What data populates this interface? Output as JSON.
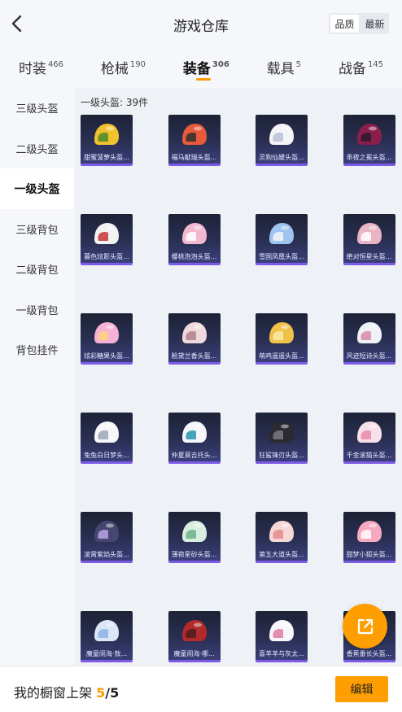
{
  "header": {
    "title": "游戏仓库",
    "sort_options": [
      "品质",
      "最新"
    ],
    "sort_selected": "品质"
  },
  "tabs": [
    {
      "label": "时装",
      "count": "466",
      "active": false
    },
    {
      "label": "枪械",
      "count": "190",
      "active": false
    },
    {
      "label": "装备",
      "count": "306",
      "active": true
    },
    {
      "label": "载具",
      "count": "5",
      "active": false
    },
    {
      "label": "战备",
      "count": "145",
      "active": false
    }
  ],
  "sidebar": {
    "items": [
      {
        "label": "三级头盔",
        "active": false
      },
      {
        "label": "二级头盔",
        "active": false
      },
      {
        "label": "一级头盔",
        "active": true
      },
      {
        "label": "三级背包",
        "active": false
      },
      {
        "label": "二级背包",
        "active": false
      },
      {
        "label": "一级背包",
        "active": false
      },
      {
        "label": "背包挂件",
        "active": false
      }
    ]
  },
  "content": {
    "heading": "一级头盔: 39件",
    "items": [
      {
        "name": "甜蜜菠萝头盔...",
        "color": "#f2c12e",
        "accent": "#4a8b2a"
      },
      {
        "name": "福马献瑞头盔...",
        "color": "#e85a3a",
        "accent": "#2f2f2f"
      },
      {
        "name": "灵狗仙媛头盔...",
        "color": "#f4f4f6",
        "accent": "#b9bfd6"
      },
      {
        "name": "乖夜之冕头盔...",
        "color": "#8a1f4c",
        "accent": "#2a1a2e"
      },
      {
        "name": "暮色炫影头盔...",
        "color": "#f2f2f2",
        "accent": "#c8323a"
      },
      {
        "name": "樱桃泡泡头盔...",
        "color": "#f2b8cf",
        "accent": "#ffffff"
      },
      {
        "name": "雪国凤凰头盔...",
        "color": "#9fc4ef",
        "accent": "#f4f4f8"
      },
      {
        "name": "绝对恒星头盔...",
        "color": "#e9b4c6",
        "accent": "#ffffff"
      },
      {
        "name": "炫彩糖果头盔...",
        "color": "#f5b0d6",
        "accent": "#ffd37a"
      },
      {
        "name": "粉黛兰香头盔...",
        "color": "#efd9dc",
        "accent": "#b08088"
      },
      {
        "name": "萌鸡遥遥头盔...",
        "color": "#f0c24a",
        "accent": "#fbeaa8"
      },
      {
        "name": "风迹短诗头盔...",
        "color": "#eef1f6",
        "accent": "#d88aa6"
      },
      {
        "name": "兔兔白日梦头...",
        "color": "#f7f7f9",
        "accent": "#9aa3b8"
      },
      {
        "name": "仲夏莫吉托头...",
        "color": "#f4f6f8",
        "accent": "#2a93b0"
      },
      {
        "name": "狂鲨锋刃头盔...",
        "color": "#2a2a30",
        "accent": "#7a7a86"
      },
      {
        "name": "千金滚猫头盔...",
        "color": "#f7e1e8",
        "accent": "#e88aaa"
      },
      {
        "name": "凌霄紫焰头盔...",
        "color": "#46466e",
        "accent": "#b9a6e8"
      },
      {
        "name": "薄荷星砂头盔...",
        "color": "#d9eedf",
        "accent": "#6ab38a"
      },
      {
        "name": "第五大道头盔...",
        "color": "#f7d6d6",
        "accent": "#e48a8a"
      },
      {
        "name": "甜梦小狐头盔...",
        "color": "#f6a9bf",
        "accent": "#ffffff"
      },
      {
        "name": "魔童闹海·敖...",
        "color": "#dbe6f7",
        "accent": "#8fb2e6"
      },
      {
        "name": "魔童闹海·哪...",
        "color": "#b32a2a",
        "accent": "#4a1e1e"
      },
      {
        "name": "喜羊羊与灰太...",
        "color": "#f7f7f9",
        "accent": "#e27aa0"
      },
      {
        "name": "香蕉番长头盔...",
        "color": "#f5d94a",
        "accent": "#ffffff"
      }
    ]
  },
  "bottom": {
    "label": "我的橱窗上架",
    "current": "5",
    "separator": "/",
    "total": "5",
    "edit_label": "编辑"
  },
  "colors": {
    "accent": "#ff9e00",
    "card_border": "#7c5ce6"
  },
  "icons": {
    "back": "chevron-left-icon",
    "share": "share-external-icon"
  }
}
